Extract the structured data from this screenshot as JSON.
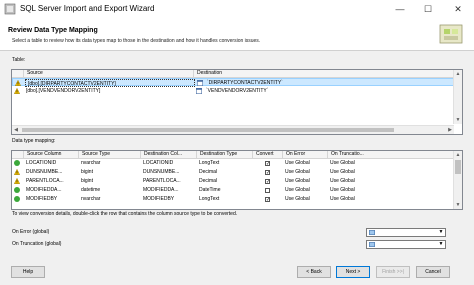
{
  "window": {
    "title": "SQL Server Import and Export Wizard",
    "minimize": "—",
    "maximize": "☐",
    "close": "✕"
  },
  "header": {
    "title": "Review Data Type Mapping",
    "subtitle": "Select a table to review how its data types map to those in the destination and how it handles conversion issues."
  },
  "table_section": {
    "label": "Table:",
    "columns": [
      "Source",
      "Destination"
    ],
    "rows": [
      {
        "status": "warning",
        "source": "[dbo].[DIRPARTYCONTACTV2ENTITY]",
        "destination": "`DIRPARTYCONTACTV2ENTITY`",
        "selected": true
      },
      {
        "status": "warning",
        "source": "[dbo].[VENDVENDORV2ENTITY]",
        "destination": "`VENDVENDORV2ENTITY`",
        "selected": false
      }
    ]
  },
  "mapping_section": {
    "label": "Data type mapping:",
    "columns": [
      "Source Column",
      "Source Type",
      "Destination Col...",
      "Destination Type",
      "Convert",
      "On Error",
      "On Truncatio..."
    ],
    "rows": [
      {
        "status": "ok",
        "source_column": "LOCATIONID",
        "source_type": "nvarchar",
        "dest_column": "LOCATIONID",
        "dest_type": "LongText",
        "convert": true,
        "on_error": "Use Global",
        "on_trunc": "Use Global"
      },
      {
        "status": "warning",
        "source_column": "DUNSNUMBE...",
        "source_type": "bigint",
        "dest_column": "DUNSNUMBE...",
        "dest_type": "Decimal",
        "convert": true,
        "on_error": "Use Global",
        "on_trunc": "Use Global"
      },
      {
        "status": "warning",
        "source_column": "PARENTLOCA...",
        "source_type": "bigint",
        "dest_column": "PARENTLOCA...",
        "dest_type": "Decimal",
        "convert": true,
        "on_error": "Use Global",
        "on_trunc": "Use Global"
      },
      {
        "status": "ok",
        "source_column": "MODIFIEDDA...",
        "source_type": "datetime",
        "dest_column": "MODIFIEDDA...",
        "dest_type": "DateTime",
        "convert": false,
        "on_error": "Use Global",
        "on_trunc": "Use Global"
      },
      {
        "status": "ok",
        "source_column": "MODIFIEDBY",
        "source_type": "nvarchar",
        "dest_column": "MODIFIEDBY",
        "dest_type": "LongText",
        "convert": true,
        "on_error": "Use Global",
        "on_trunc": "Use Global"
      }
    ],
    "hint": "To view conversion details, double-click the row that contains the column source type to be converted."
  },
  "globals": {
    "on_error_label": "On Error (global)",
    "on_truncation_label": "On Truncation (global)"
  },
  "buttons": {
    "help": "Help",
    "back": "< Back",
    "next": "Next >",
    "finish": "Finish >>|",
    "cancel": "Cancel"
  },
  "colors": {
    "selection": "#cce8ff",
    "default_button_border": "#0078d7",
    "warning": "#f5c400"
  }
}
